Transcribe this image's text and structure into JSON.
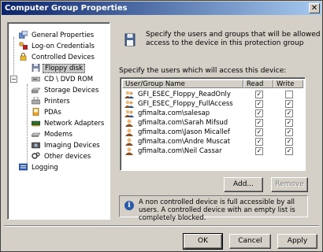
{
  "window": {
    "title": "Computer Group Properties",
    "close_glyph": "✕"
  },
  "tree": {
    "items": [
      {
        "label": "General Properties",
        "icon": "general-properties-icon"
      },
      {
        "label": "Log-on Credentials",
        "icon": "credentials-icon"
      },
      {
        "label": "Controlled Devices",
        "icon": "lock-icon",
        "expander": "−"
      },
      {
        "label": "Floppy disk",
        "icon": "floppy-disk-icon",
        "selected": true
      },
      {
        "label": "CD \\ DVD ROM",
        "icon": "cd-dvd-icon"
      },
      {
        "label": "Storage Devices",
        "icon": "storage-device-icon"
      },
      {
        "label": "Printers",
        "icon": "printer-icon"
      },
      {
        "label": "PDAs",
        "icon": "pda-icon"
      },
      {
        "label": "Network Adapters",
        "icon": "network-adapter-icon"
      },
      {
        "label": "Modems",
        "icon": "modem-icon"
      },
      {
        "label": "Imaging Devices",
        "icon": "imaging-device-icon"
      },
      {
        "label": "Other devices",
        "icon": "other-devices-icon"
      },
      {
        "label": "Logging",
        "icon": "logging-icon"
      }
    ]
  },
  "header": {
    "description": "Specify the users and groups that will be allowed access to the device in this protection group",
    "icon": "floppy-disk-icon"
  },
  "list": {
    "label": "Specify the users which will access this device:",
    "columns": {
      "name": "User/Group Name",
      "read": "Read",
      "write": "Write"
    },
    "rows": [
      {
        "name": "GFI_ESEC_Floppy_ReadOnly",
        "read": true,
        "write": false
      },
      {
        "name": "GFI_ESEC_Floppy_FullAccess",
        "read": true,
        "write": true
      },
      {
        "name": "gfimalta.com\\salesap",
        "read": true,
        "write": true
      },
      {
        "name": "gfimalta.com\\Sarah Mifsud",
        "read": true,
        "write": true
      },
      {
        "name": "gfimalta.com\\Jason Micallef",
        "read": true,
        "write": true
      },
      {
        "name": "gfimalta.com\\Andre Muscat",
        "read": true,
        "write": true
      },
      {
        "name": "gfimalta.com\\Neil Cassar",
        "read": true,
        "write": true
      }
    ],
    "check_glyph": "✓"
  },
  "buttons": {
    "add": "Add...",
    "remove": "Remove",
    "ok": "OK",
    "cancel": "Cancel",
    "apply": "Apply"
  },
  "info": {
    "icon_glyph": "i",
    "text": "A non controlled device is full accessible by all users. A controlled device with an empty list is completely blocked."
  },
  "colors": {
    "title_start": "#0a246a",
    "title_end": "#a6caf0",
    "dialog_bg": "#d4d0c8"
  }
}
